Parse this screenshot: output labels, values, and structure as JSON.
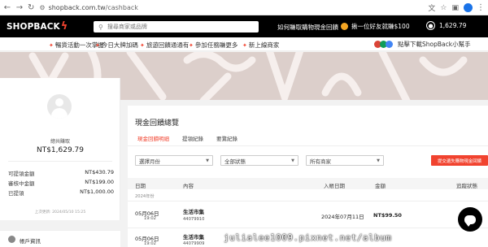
{
  "browser": {
    "url_domain": "shopback.com.tw",
    "url_path": "/cashback"
  },
  "header": {
    "logo_text": "SHOPBACK",
    "search_placeholder": "搜尋商家或品牌",
    "cashback_link": "如何賺取購物現金回饋",
    "invite_text": "揪一位好友就賺$100",
    "user_amount": "1,629.79"
  },
  "promo_nav": {
    "items": [
      "暢貨活動一次掌握",
      "今日大牌加碼",
      "旅遊回饋通通有",
      "參加任務賺更多",
      "新上線商家"
    ],
    "app_download": "點擊下載ShopBack小幫手"
  },
  "profile": {
    "label": "總共賺取",
    "total": "NT$1,629.79",
    "rows": [
      {
        "label": "可提領金額",
        "value": "NT$430.79"
      },
      {
        "label": "審核中金額",
        "value": "NT$199.00"
      },
      {
        "label": "已提領",
        "value": "NT$1,000.00"
      }
    ],
    "updated": "上次更新: 2024/05/10 15:25"
  },
  "account": {
    "label": "帳戶資訊"
  },
  "main": {
    "title": "現金回饋總覽",
    "tabs": [
      "現金回饋明細",
      "提領紀錄",
      "要鶩紀錄"
    ],
    "filters": {
      "month": "選擇月份",
      "status": "全部狀態",
      "merchant": "所有商家"
    },
    "submit_label": "提交遺失購物現金回饋",
    "table": {
      "headers": [
        "日期",
        "內容",
        "入帳日期",
        "金額",
        "追蹤狀態"
      ],
      "year_label": "2024年份",
      "rows": [
        {
          "date": "05月06日",
          "time": "19:02",
          "content": "生活市集",
          "order": "44079910",
          "credit_date": "2024年07月11日",
          "amount": "NT$99.50"
        },
        {
          "date": "05月06日",
          "time": "19:02",
          "content": "生活市集",
          "order": "44079909",
          "credit_date": "",
          "amount": ""
        }
      ]
    }
  },
  "watermark": "julialee1009.pixnet.net/album",
  "colors": {
    "brand_red": "#f1432f",
    "header_black": "#000000",
    "banner_bg": "#dccfcb",
    "coin": "#f5a623"
  },
  "icons": {
    "search": "search-icon",
    "coin": "coin-icon",
    "user": "user-icon",
    "chat": "chat-icon"
  }
}
